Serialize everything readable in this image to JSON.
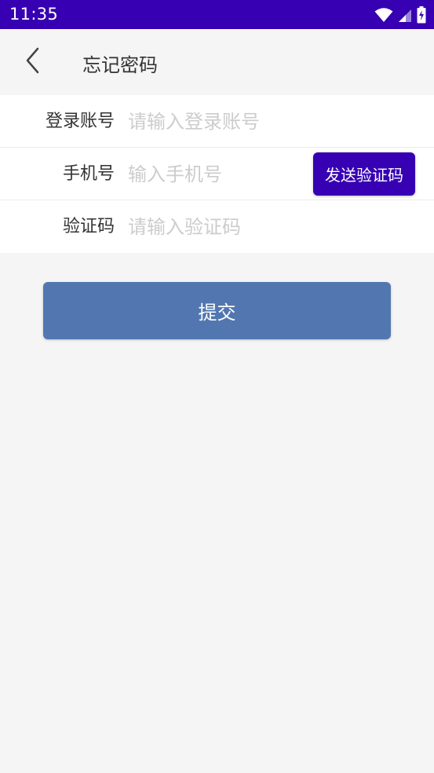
{
  "status_bar": {
    "time": "11:35",
    "icons": [
      "wifi-icon",
      "cellular-signal-icon",
      "battery-charging-icon"
    ],
    "background": "#3700b3"
  },
  "app_bar": {
    "back_icon": "chevron-left-icon",
    "title": "忘记密码"
  },
  "form": {
    "account": {
      "label": "登录账号",
      "placeholder": "请输入登录账号",
      "value": ""
    },
    "phone": {
      "label": "手机号",
      "placeholder": "输入手机号",
      "value": ""
    },
    "send_code_label": "发送验证码",
    "code": {
      "label": "验证码",
      "placeholder": "请输入验证码",
      "value": ""
    }
  },
  "submit_label": "提交",
  "colors": {
    "primary": "#3700b3",
    "submit": "#5277b0",
    "background": "#f5f5f5"
  }
}
